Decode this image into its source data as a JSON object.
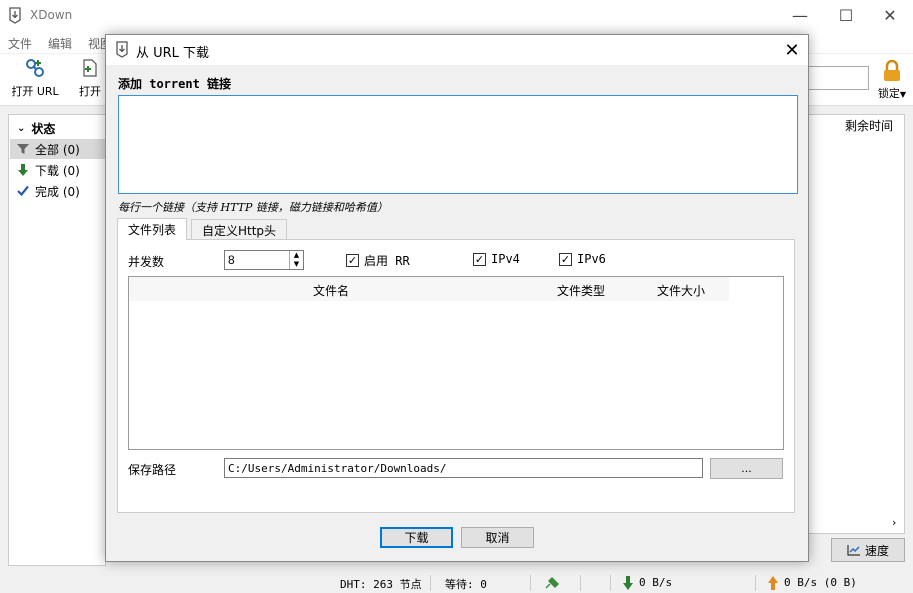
{
  "window": {
    "title": "XDown",
    "minimize_glyph": "—",
    "maximize_glyph": "☐",
    "close_glyph": "✕"
  },
  "menu": [
    "文件",
    "编辑",
    "视图"
  ],
  "toolbar": {
    "open_url_label": "打开 URL",
    "open_label": "打开",
    "lock_label": "锁定"
  },
  "sidebar": {
    "header": "状态",
    "items": [
      {
        "label": "全部 (0)",
        "icon": "filter-icon"
      },
      {
        "label": "下载 (0)",
        "icon": "download-arrow-icon"
      },
      {
        "label": "完成 (0)",
        "icon": "checkmark-icon"
      }
    ]
  },
  "list": {
    "col_remaining": "剩余时间"
  },
  "speed_button": "速度",
  "statusbar": {
    "dht": "DHT: 263 节点",
    "waiting": "等待: 0",
    "down_speed": "0 B/s",
    "up_speed": "0 B/s (0 B)"
  },
  "dialog": {
    "title": "从 URL 下载",
    "torrent_label": "添加 torrent 链接",
    "torrent_value": "",
    "hint": "每行一个链接（支持 HTTP 链接，磁力链接和哈希值）",
    "tabs": [
      "文件列表",
      "自定义Http头"
    ],
    "concurrency_label": "并发数",
    "concurrency_value": "8",
    "checkboxes": [
      {
        "label": "启用 RR",
        "checked": true
      },
      {
        "label": "IPv4",
        "checked": true
      },
      {
        "label": "IPv6",
        "checked": true
      }
    ],
    "table_headers": [
      "文件名",
      "文件类型",
      "文件大小"
    ],
    "save_path_label": "保存路径",
    "save_path_value": "C:/Users/Administrator/Downloads/",
    "browse_label": "...",
    "download_button": "下载",
    "cancel_button": "取消"
  },
  "colors": {
    "accent": "#0078d7",
    "download_green": "#2e7d32",
    "upload_orange": "#e08a1e"
  }
}
